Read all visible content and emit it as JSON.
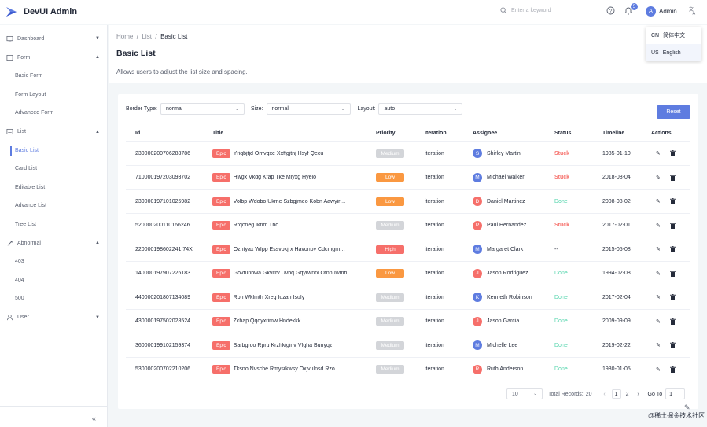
{
  "app": {
    "title": "DevUI Admin",
    "brand_color": "#5e7ce0"
  },
  "header": {
    "search_placeholder": "Enter a keyword",
    "notification_count": "5",
    "user_initial": "A",
    "user_name": "Admin",
    "icons": [
      "search-icon",
      "help-icon",
      "bell-icon",
      "translate-icon"
    ]
  },
  "language_menu": [
    {
      "code": "CN",
      "label": "简体中文"
    },
    {
      "code": "US",
      "label": "English"
    }
  ],
  "sidebar": {
    "groups": [
      {
        "label": "Dashboard",
        "icon": "dashboard-icon",
        "caret": "▼"
      },
      {
        "label": "Form",
        "icon": "form-icon",
        "caret": "▲",
        "items": [
          "Basic Form",
          "Form Layout",
          "Advanced Form"
        ]
      },
      {
        "label": "List",
        "icon": "list-icon",
        "caret": "▲",
        "items": [
          "Basic List",
          "Card List",
          "Editable List",
          "Advance List",
          "Tree List"
        ]
      },
      {
        "label": "Abnormal",
        "icon": "abnormal-icon",
        "caret": "▲",
        "items": [
          "403",
          "404",
          "500"
        ]
      },
      {
        "label": "User",
        "icon": "user-icon",
        "caret": "▼"
      }
    ],
    "active_item": "Basic List",
    "collapse_label": "«"
  },
  "breadcrumb": [
    "Home",
    "List",
    "Basic List"
  ],
  "page": {
    "title": "Basic List",
    "description": "Allows users to adjust the list size and spacing."
  },
  "filters": {
    "border_type": {
      "label": "Border Type:",
      "value": "normal"
    },
    "size": {
      "label": "Size:",
      "value": "normal"
    },
    "layout": {
      "label": "Layout:",
      "value": "auto"
    },
    "reset_label": "Reset"
  },
  "table": {
    "columns": [
      "Id",
      "Title",
      "Priority",
      "Iteration",
      "Assignee",
      "Status",
      "Timeline",
      "Actions"
    ],
    "rows": [
      {
        "id": "230000200706283786",
        "tag": "Epic",
        "title": "Yriqbjtjd Omvqxe Xxffgjtnj Hsyf Qecu",
        "priority": "Medium",
        "iteration": "iteration",
        "initial": "S",
        "avatar_color": "#5e7ce0",
        "assignee": "Shirley Martin",
        "status": "Stuck",
        "timeline": "1985-01-10"
      },
      {
        "id": "710000197203093702",
        "tag": "Epic",
        "title": "Hwgx Vkdg Kfap Tke Miyxg Hyelo",
        "priority": "Low",
        "iteration": "iteration",
        "initial": "M",
        "avatar_color": "#5e7ce0",
        "assignee": "Michael Walker",
        "status": "Stuck",
        "timeline": "2018-08-04"
      },
      {
        "id": "230000197101025982",
        "tag": "Epic",
        "title": "Volbp Wdobo Ukme Szbgjmeo Kobn Aawyir…",
        "priority": "Low",
        "iteration": "iteration",
        "initial": "D",
        "avatar_color": "#f66f6a",
        "assignee": "Daniel Martinez",
        "status": "Done",
        "timeline": "2008-08-02"
      },
      {
        "id": "520000200110166246",
        "tag": "Epic",
        "title": "Rrqcneg Iknm Tbo",
        "priority": "Medium",
        "iteration": "iteration",
        "initial": "P",
        "avatar_color": "#f66f6a",
        "assignee": "Paul Hernandez",
        "status": "Stuck",
        "timeline": "2017-02-01"
      },
      {
        "id": "220000198602241 74X",
        "tag": "Epic",
        "title": "Ozhtyax Wfpp Essvpkjrx Havonov Cdcmgmg…",
        "priority": "High",
        "iteration": "iteration",
        "initial": "M",
        "avatar_color": "#5e7ce0",
        "assignee": "Margaret Clark",
        "status": "--",
        "timeline": "2015-05-08"
      },
      {
        "id": "140000197907226183",
        "tag": "Epic",
        "title": "Govfunhwa Gkvcrv Uvbq Gqyrwntx Ofnnuwmh",
        "priority": "Low",
        "iteration": "iteration",
        "initial": "J",
        "avatar_color": "#f66f6a",
        "assignee": "Jason Rodriguez",
        "status": "Done",
        "timeline": "1994-02-08"
      },
      {
        "id": "440000201807134089",
        "tag": "Epic",
        "title": "Rbh Wklmth Xreg Iuzan Isufy",
        "priority": "Medium",
        "iteration": "iteration",
        "initial": "K",
        "avatar_color": "#5e7ce0",
        "assignee": "Kenneth Robinson",
        "status": "Done",
        "timeline": "2017-02-04"
      },
      {
        "id": "430000197502028524",
        "tag": "Epic",
        "title": "Zcbap Qqoyxrimw Hndekkk",
        "priority": "Medium",
        "iteration": "iteration",
        "initial": "J",
        "avatar_color": "#f66f6a",
        "assignee": "Jason Garcia",
        "status": "Done",
        "timeline": "2009-09-09"
      },
      {
        "id": "360000199102159374",
        "tag": "Epic",
        "title": "Sarbgroo Rpru Krzhkiginv Vfgha Bunyqz",
        "priority": "Medium",
        "iteration": "iteration",
        "initial": "M",
        "avatar_color": "#5e7ce0",
        "assignee": "Michelle Lee",
        "status": "Done",
        "timeline": "2019-02-22"
      },
      {
        "id": "530000200702210206",
        "tag": "Epic",
        "title": "Tksno Nvsche Rmysrkwsy Oxjvulnsd Rzo",
        "priority": "Medium",
        "iteration": "iteration",
        "initial": "R",
        "avatar_color": "#f66f6a",
        "assignee": "Ruth Anderson",
        "status": "Done",
        "timeline": "1980-01-05"
      }
    ]
  },
  "colors": {
    "priority": {
      "Medium": "#d3d5d9",
      "Low": "#fa9841",
      "High": "#f66f6a"
    },
    "status": {
      "Stuck": "#f66f6a",
      "Done": "#50d4ab",
      "--": "#252b3a"
    }
  },
  "pagination": {
    "page_size": "10",
    "total_label": "Total Records:",
    "total": "20",
    "prev": "‹",
    "pages": [
      "1",
      "2"
    ],
    "next": "›",
    "current": "1",
    "goto_label": "Go To",
    "goto_value": "1"
  },
  "watermark": "@稀土掘金技术社区"
}
